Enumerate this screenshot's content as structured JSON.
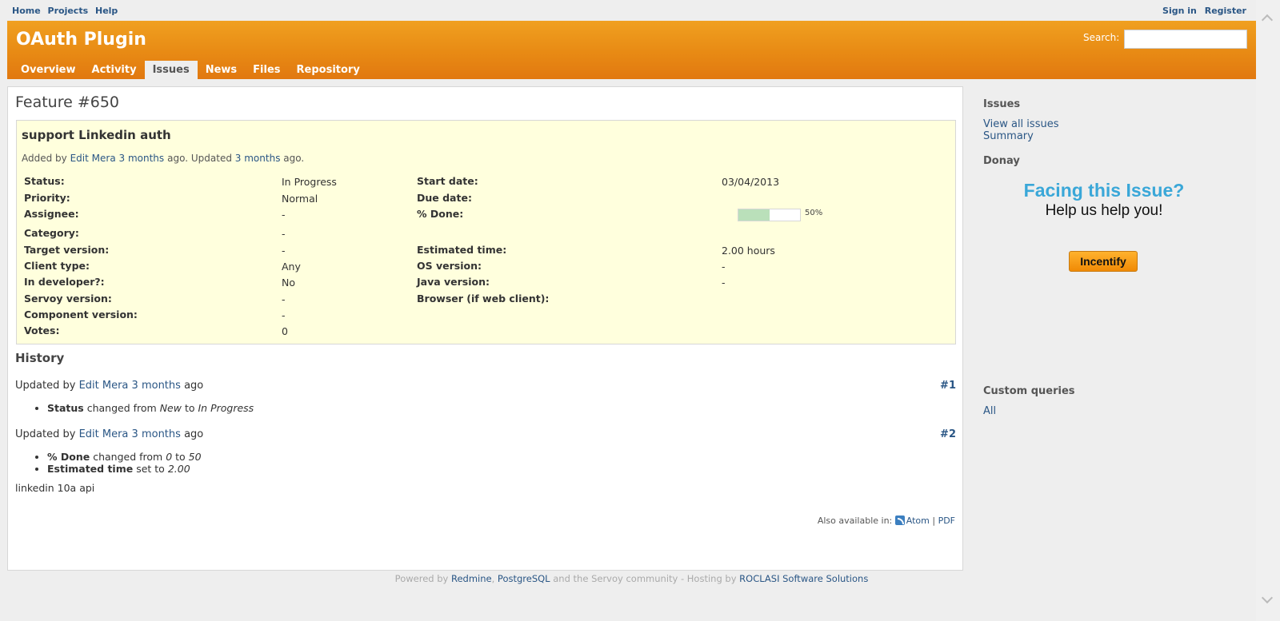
{
  "top_menu": {
    "left": [
      "Home",
      "Projects",
      "Help"
    ],
    "right": [
      "Sign in",
      "Register"
    ]
  },
  "header": {
    "title": "OAuth Plugin",
    "search_label": "Search:",
    "search_value": ""
  },
  "main_menu": {
    "tabs": [
      "Overview",
      "Activity",
      "Issues",
      "News",
      "Files",
      "Repository"
    ],
    "selected": "Issues"
  },
  "issue": {
    "heading": "Feature #650",
    "subject": "support Linkedin auth",
    "added_by_prefix": "Added by",
    "author": "Edit Mera",
    "added_ago": "3 months",
    "ago_updated": "ago. Updated",
    "updated_ago": "3 months",
    "ago_end": "ago.",
    "attributes_left": [
      {
        "label": "Status:",
        "value": "In Progress"
      },
      {
        "label": "Priority:",
        "value": "Normal"
      },
      {
        "label": "Assignee:",
        "value": "-"
      },
      {
        "label": "Category:",
        "value": "-"
      },
      {
        "label": "Target version:",
        "value": "-"
      },
      {
        "label": "Client type:",
        "value": "Any"
      },
      {
        "label": "In developer?:",
        "value": "No"
      },
      {
        "label": "Servoy version:",
        "value": "-"
      },
      {
        "label": "Component version:",
        "value": "-"
      },
      {
        "label": "Votes:",
        "value": "0"
      }
    ],
    "attributes_right": [
      {
        "label": "Start date:",
        "value": "03/04/2013"
      },
      {
        "label": "Due date:",
        "value": ""
      },
      {
        "label": "% Done:",
        "value": ""
      },
      {
        "label": "Estimated time:",
        "value": "2.00 hours"
      },
      {
        "label": "OS version:",
        "value": "-"
      },
      {
        "label": "Java version:",
        "value": "-"
      },
      {
        "label": "Browser (if web client):",
        "value": ""
      }
    ],
    "done_percent": 50,
    "done_label": "50%"
  },
  "history": {
    "title": "History",
    "journals": [
      {
        "prefix": "Updated by",
        "author": "Edit Mera",
        "ago": "3 months",
        "suffix": "ago",
        "number": "#1",
        "details": [
          {
            "field": "Status",
            "text1": "changed from",
            "old": "New",
            "text2": "to",
            "new": "In Progress"
          }
        ]
      },
      {
        "prefix": "Updated by",
        "author": "Edit Mera",
        "ago": "3 months",
        "suffix": "ago",
        "number": "#2",
        "details": [
          {
            "field": "% Done",
            "text1": "changed from",
            "old": "0",
            "text2": "to",
            "new": "50"
          },
          {
            "field": "Estimated time",
            "text1": "set to",
            "old": "",
            "text2": "",
            "new": "2.00"
          }
        ],
        "notes": "linkedin 10a api"
      }
    ]
  },
  "also_available": {
    "label": "Also available in:",
    "atom": "Atom",
    "separator": "|",
    "pdf": "PDF"
  },
  "sidebar": {
    "issues_heading": "Issues",
    "view_all": "View all issues",
    "summary": "Summary",
    "donay_heading": "Donay",
    "donay_title": "Facing this Issue?",
    "donay_sub": "Help us help you!",
    "incentify": "Incentify",
    "custom_heading": "Custom queries",
    "all": "All"
  },
  "footer": {
    "powered_by": "Powered by",
    "redmine": "Redmine",
    "comma": ",",
    "postgresql": "PostgreSQL",
    "and_text": "and the Servoy community - Hosting by",
    "roclasi": "ROCLASI Software Solutions"
  },
  "colors": {
    "header_orange": "#e88a14",
    "link_blue": "#2a5685",
    "issue_bg": "#ffffdd",
    "progress_fill": "#bae0ba",
    "donay_blue": "#3aa7d8"
  }
}
